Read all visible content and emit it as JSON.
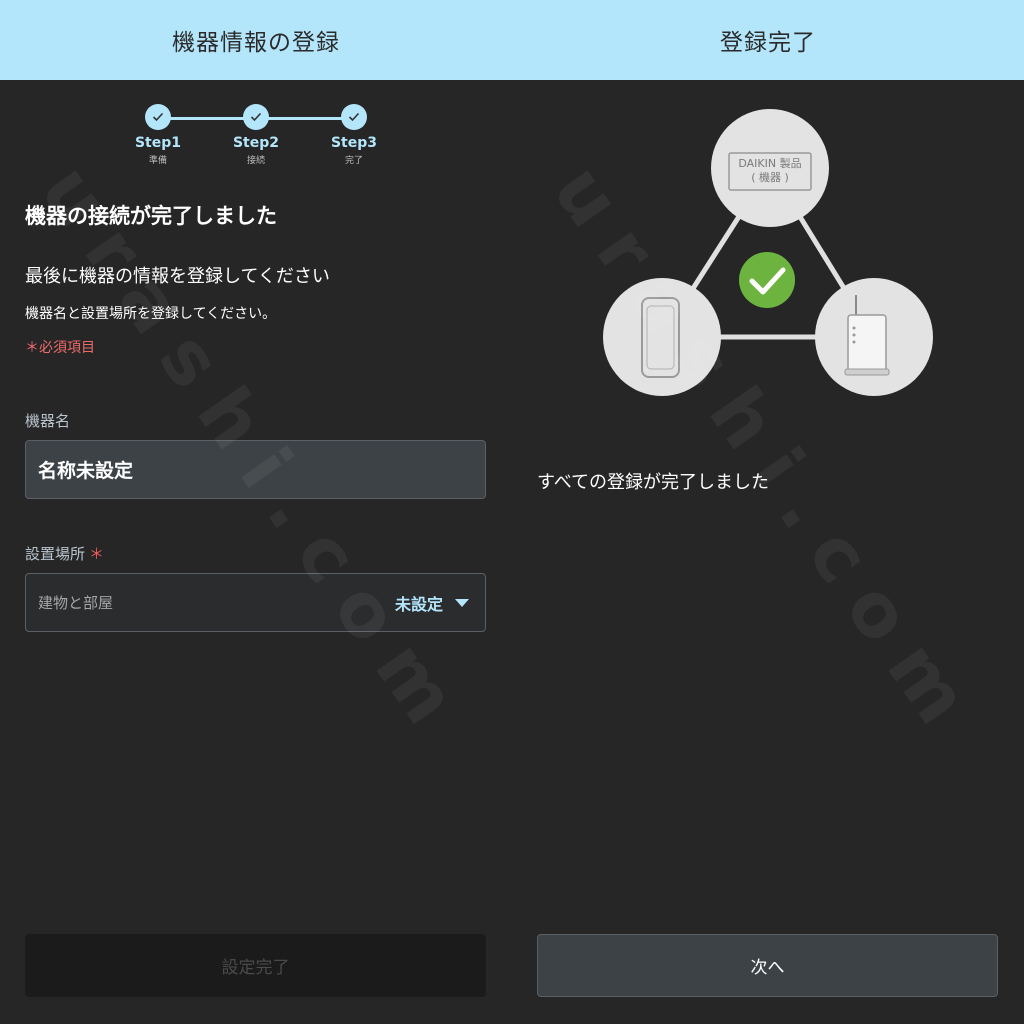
{
  "left": {
    "header": "機器情報の登録",
    "steps": [
      {
        "name": "Step1",
        "sub": "準備"
      },
      {
        "name": "Step2",
        "sub": "接続"
      },
      {
        "name": "Step3",
        "sub": "完了"
      }
    ],
    "title": "機器の接続が完了しました",
    "lead": "最後に機器の情報を登録してください",
    "desc": "機器名と設置場所を登録してください。",
    "required_note": "＊必須項目",
    "name_label": "機器名",
    "name_value": "名称未設定",
    "location_label": "設置場所",
    "required_mark": "＊",
    "location_placeholder": "建物と部屋",
    "location_value": "未設定",
    "submit_label": "設定完了"
  },
  "right": {
    "header": "登録完了",
    "device_label_line1": "DAIKIN 製品",
    "device_label_line2": "( 機器 )",
    "complete_text": "すべての登録が完了しました",
    "next_label": "次へ"
  },
  "watermark": "urashi.com",
  "colors": {
    "header_bg": "#b3e5fb",
    "accent": "#b3e5fb",
    "check_green": "#6db33f",
    "required_red": "#ef5a5a"
  }
}
